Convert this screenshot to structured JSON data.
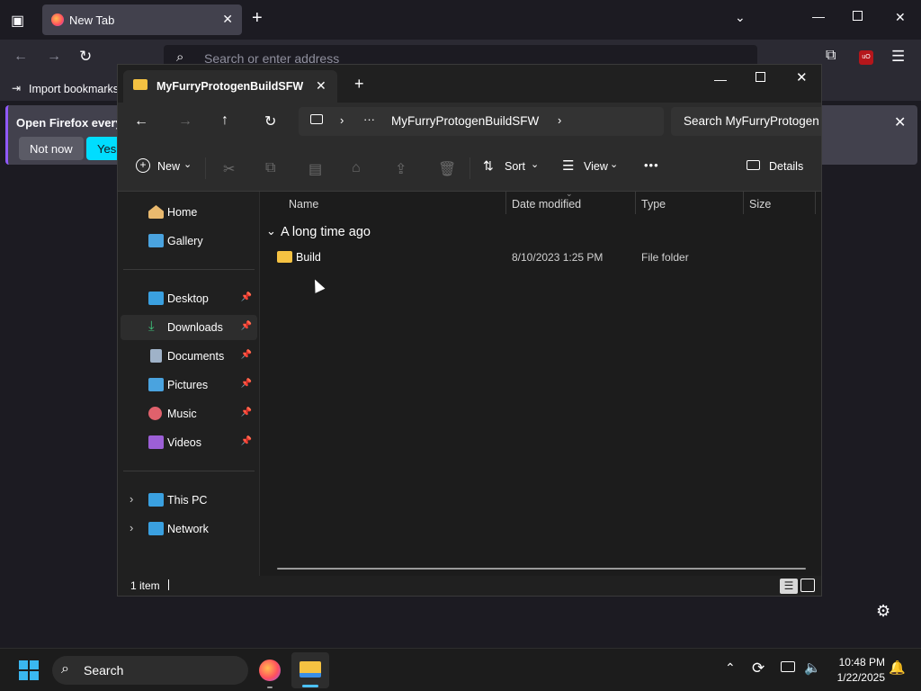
{
  "firefox": {
    "tab_title": "New Tab",
    "address_placeholder": "Search or enter address",
    "import_bookmarks": "Import bookmarks",
    "notification_text": "Open Firefox every",
    "not_now": "Not now",
    "yes": "Yes,"
  },
  "explorer": {
    "tab_title": "MyFurryProtogenBuildSFW",
    "breadcrumb_ellipsis": "···",
    "breadcrumb_folder": "MyFurryProtogenBuildSFW",
    "search_placeholder": "Search MyFurryProtogen",
    "commands": {
      "new": "New",
      "sort": "Sort",
      "view": "View",
      "more": "•••",
      "details": "Details"
    },
    "nav": {
      "home": "Home",
      "gallery": "Gallery",
      "desktop": "Desktop",
      "downloads": "Downloads",
      "documents": "Documents",
      "pictures": "Pictures",
      "music": "Music",
      "videos": "Videos",
      "this_pc": "This PC",
      "network": "Network"
    },
    "columns": [
      "Name",
      "Date modified",
      "Type",
      "Size"
    ],
    "group_label": "A long time ago",
    "files": [
      {
        "name": "Build",
        "date": "8/10/2023 1:25 PM",
        "type": "File folder",
        "size": ""
      }
    ],
    "status": "1 item"
  },
  "taskbar": {
    "search_label": "Search",
    "time": "10:48 PM",
    "date": "1/22/2025"
  }
}
